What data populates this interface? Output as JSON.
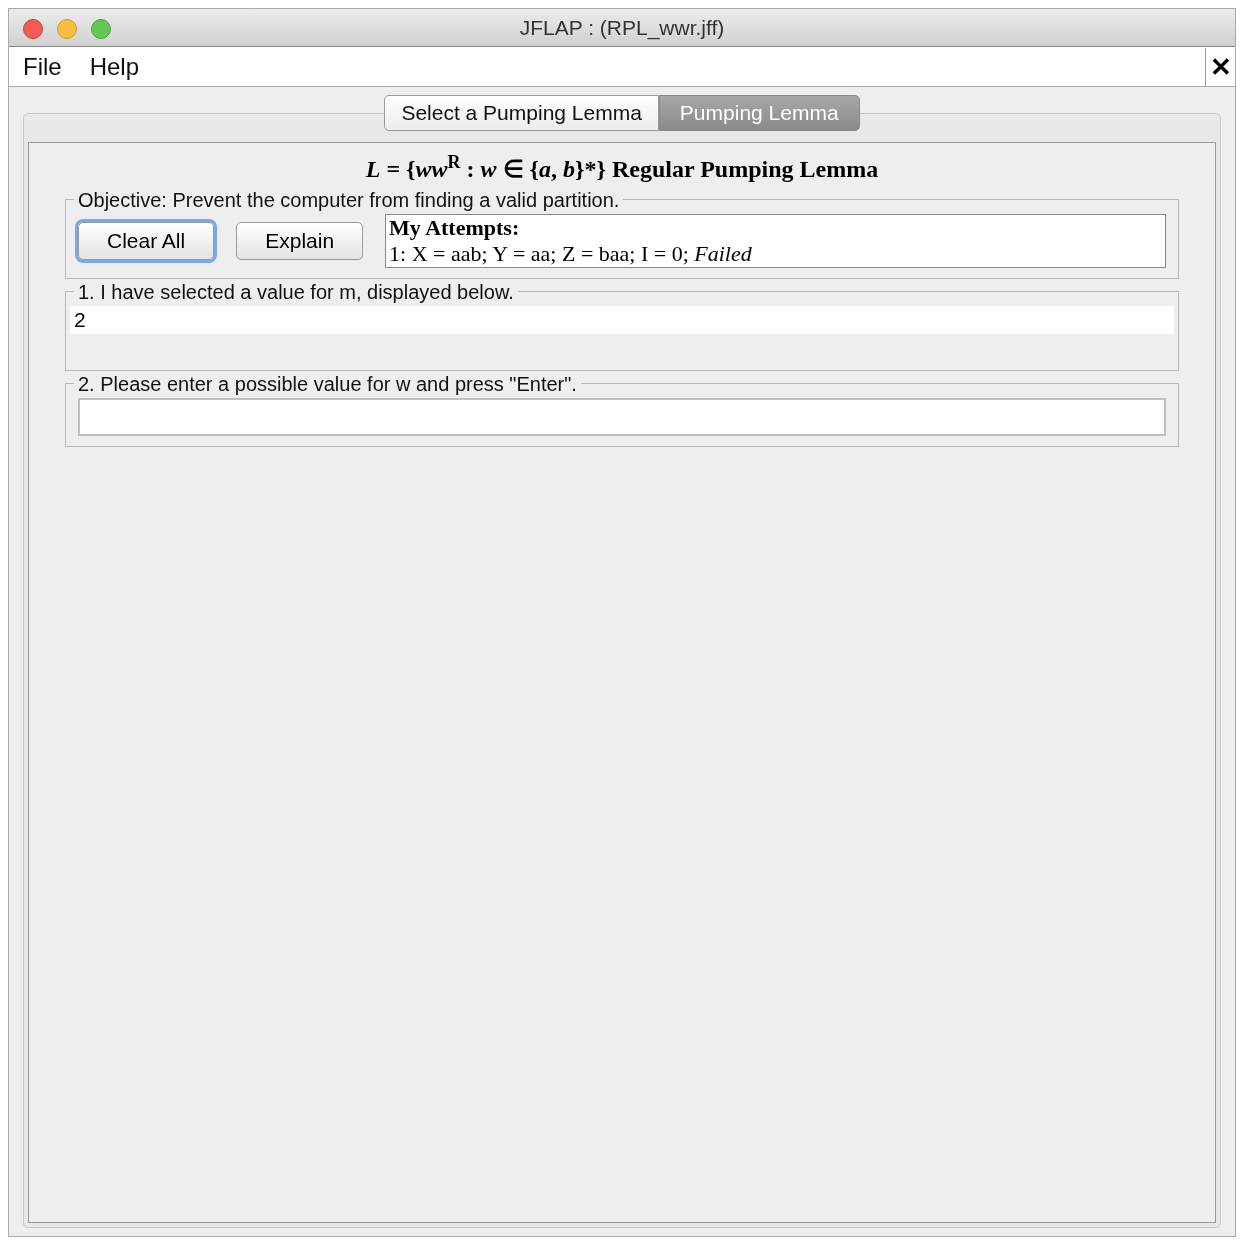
{
  "window": {
    "title": "JFLAP : (RPL_wwr.jff)"
  },
  "menu": [
    "File",
    "Help"
  ],
  "close_button": "✕",
  "tabs": [
    {
      "label": "Select a Pumping Lemma",
      "selected": false
    },
    {
      "label": "Pumping Lemma",
      "selected": true
    }
  ],
  "heading": "*L* = {*ww*$^{R}$ : *w* ∈ {*a*, *b*}*} Regular Pumping Lemma",
  "objective": {
    "legend": "Objective: Prevent the computer from finding a valid partition.",
    "buttons": [
      {
        "label": "Clear All",
        "focused": true
      },
      {
        "label": "Explain",
        "focused": false
      }
    ],
    "attempts_title": "My Attempts:",
    "attempts": [
      "1: X = aab; Y = aa; Z = baa; I = 0; *Failed*"
    ]
  },
  "step1": {
    "legend": "1. I have selected a value for m, displayed below.",
    "value": "2"
  },
  "step2": {
    "legend": "2. Please enter a possible value for w and press \"Enter\"."
  }
}
